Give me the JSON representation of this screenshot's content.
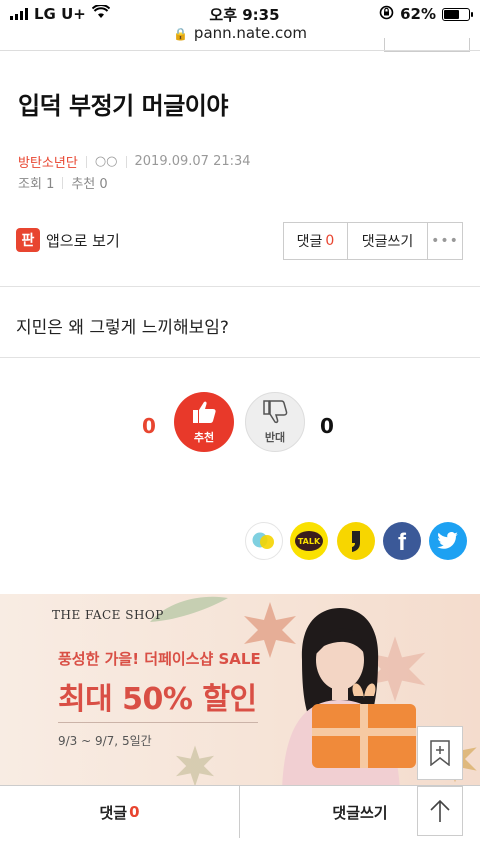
{
  "status_bar": {
    "carrier": "LG U+",
    "time": "오후 9:35",
    "battery_percent": "62%",
    "battery_level": 0.62
  },
  "browser": {
    "url": "pann.nate.com"
  },
  "post": {
    "title": "입덕 부정기 머글이야",
    "board": "방탄소년단",
    "author": "○○",
    "datetime": "2019.09.07 21:34",
    "views_label": "조회",
    "views": "1",
    "recommend_label": "추천",
    "recommend": "0",
    "content": "지민은 왜 그렇게 느끼해보임?"
  },
  "actions": {
    "app_icon_text": "판",
    "app_view": "앱으로 보기",
    "comments_label": "댓글",
    "comments_count": "0",
    "write_comment": "댓글쓰기",
    "more": "•••"
  },
  "votes": {
    "up_count": "0",
    "up_label": "추천",
    "down_label": "반대",
    "down_count": "0"
  },
  "share": {
    "kakaotalk_label": "TALK"
  },
  "ad": {
    "brand": "THE FACE SHOP",
    "subtitle": "풍성한 가을! 더페이스샵 SALE",
    "headline": "최대 50% 할인",
    "dates": "9/3 ~ 9/7, 5일간"
  },
  "bottom_bar": {
    "comments_label": "댓글",
    "comments_count": "0",
    "write_comment": "댓글쓰기"
  },
  "colors": {
    "accent": "#e84530",
    "kakao_yellow": "#fae100",
    "facebook": "#3b5998",
    "twitter": "#1da1f2"
  }
}
